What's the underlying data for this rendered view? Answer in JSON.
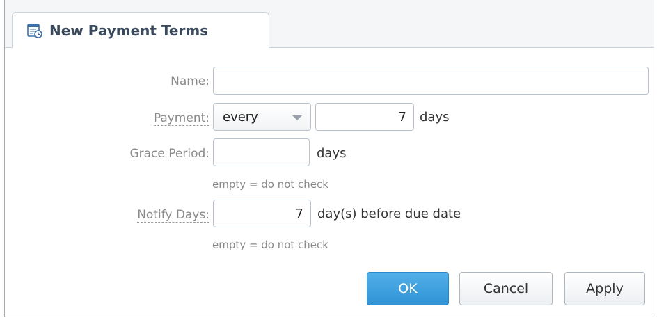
{
  "tab": {
    "icon": "payment-terms-icon",
    "title": "New Payment Terms"
  },
  "form": {
    "name": {
      "label": "Name:",
      "value": ""
    },
    "payment": {
      "label": "Payment:",
      "frequency": "every",
      "amount": "7",
      "unit": "days"
    },
    "grace_period": {
      "label": "Grace Period:",
      "value": "",
      "unit": "days",
      "hint": "empty = do not check"
    },
    "notify_days": {
      "label": "Notify Days:",
      "value": "7",
      "unit": "day(s) before due date",
      "hint": "empty = do not check"
    }
  },
  "buttons": {
    "ok": "OK",
    "cancel": "Cancel",
    "apply": "Apply"
  },
  "colors": {
    "primary": "#3fa0e0",
    "tab_title": "#3a4a5c",
    "label": "#8a8a8a"
  }
}
